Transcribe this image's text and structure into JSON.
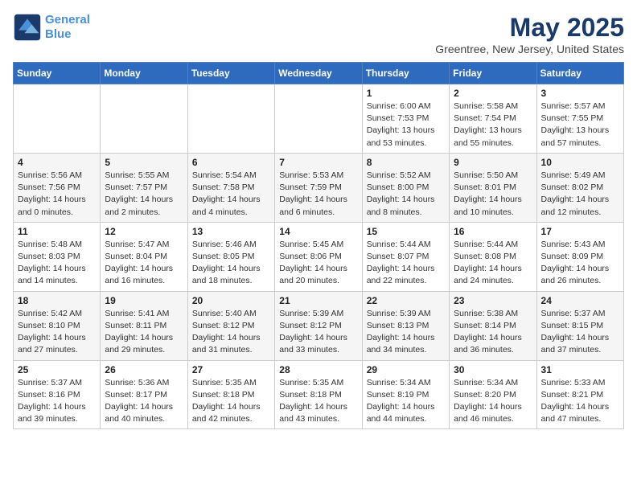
{
  "header": {
    "logo_line1": "General",
    "logo_line2": "Blue",
    "month": "May 2025",
    "location": "Greentree, New Jersey, United States"
  },
  "weekdays": [
    "Sunday",
    "Monday",
    "Tuesday",
    "Wednesday",
    "Thursday",
    "Friday",
    "Saturday"
  ],
  "weeks": [
    [
      {
        "day": "",
        "info": ""
      },
      {
        "day": "",
        "info": ""
      },
      {
        "day": "",
        "info": ""
      },
      {
        "day": "",
        "info": ""
      },
      {
        "day": "1",
        "info": "Sunrise: 6:00 AM\nSunset: 7:53 PM\nDaylight: 13 hours\nand 53 minutes."
      },
      {
        "day": "2",
        "info": "Sunrise: 5:58 AM\nSunset: 7:54 PM\nDaylight: 13 hours\nand 55 minutes."
      },
      {
        "day": "3",
        "info": "Sunrise: 5:57 AM\nSunset: 7:55 PM\nDaylight: 13 hours\nand 57 minutes."
      }
    ],
    [
      {
        "day": "4",
        "info": "Sunrise: 5:56 AM\nSunset: 7:56 PM\nDaylight: 14 hours\nand 0 minutes."
      },
      {
        "day": "5",
        "info": "Sunrise: 5:55 AM\nSunset: 7:57 PM\nDaylight: 14 hours\nand 2 minutes."
      },
      {
        "day": "6",
        "info": "Sunrise: 5:54 AM\nSunset: 7:58 PM\nDaylight: 14 hours\nand 4 minutes."
      },
      {
        "day": "7",
        "info": "Sunrise: 5:53 AM\nSunset: 7:59 PM\nDaylight: 14 hours\nand 6 minutes."
      },
      {
        "day": "8",
        "info": "Sunrise: 5:52 AM\nSunset: 8:00 PM\nDaylight: 14 hours\nand 8 minutes."
      },
      {
        "day": "9",
        "info": "Sunrise: 5:50 AM\nSunset: 8:01 PM\nDaylight: 14 hours\nand 10 minutes."
      },
      {
        "day": "10",
        "info": "Sunrise: 5:49 AM\nSunset: 8:02 PM\nDaylight: 14 hours\nand 12 minutes."
      }
    ],
    [
      {
        "day": "11",
        "info": "Sunrise: 5:48 AM\nSunset: 8:03 PM\nDaylight: 14 hours\nand 14 minutes."
      },
      {
        "day": "12",
        "info": "Sunrise: 5:47 AM\nSunset: 8:04 PM\nDaylight: 14 hours\nand 16 minutes."
      },
      {
        "day": "13",
        "info": "Sunrise: 5:46 AM\nSunset: 8:05 PM\nDaylight: 14 hours\nand 18 minutes."
      },
      {
        "day": "14",
        "info": "Sunrise: 5:45 AM\nSunset: 8:06 PM\nDaylight: 14 hours\nand 20 minutes."
      },
      {
        "day": "15",
        "info": "Sunrise: 5:44 AM\nSunset: 8:07 PM\nDaylight: 14 hours\nand 22 minutes."
      },
      {
        "day": "16",
        "info": "Sunrise: 5:44 AM\nSunset: 8:08 PM\nDaylight: 14 hours\nand 24 minutes."
      },
      {
        "day": "17",
        "info": "Sunrise: 5:43 AM\nSunset: 8:09 PM\nDaylight: 14 hours\nand 26 minutes."
      }
    ],
    [
      {
        "day": "18",
        "info": "Sunrise: 5:42 AM\nSunset: 8:10 PM\nDaylight: 14 hours\nand 27 minutes."
      },
      {
        "day": "19",
        "info": "Sunrise: 5:41 AM\nSunset: 8:11 PM\nDaylight: 14 hours\nand 29 minutes."
      },
      {
        "day": "20",
        "info": "Sunrise: 5:40 AM\nSunset: 8:12 PM\nDaylight: 14 hours\nand 31 minutes."
      },
      {
        "day": "21",
        "info": "Sunrise: 5:39 AM\nSunset: 8:12 PM\nDaylight: 14 hours\nand 33 minutes."
      },
      {
        "day": "22",
        "info": "Sunrise: 5:39 AM\nSunset: 8:13 PM\nDaylight: 14 hours\nand 34 minutes."
      },
      {
        "day": "23",
        "info": "Sunrise: 5:38 AM\nSunset: 8:14 PM\nDaylight: 14 hours\nand 36 minutes."
      },
      {
        "day": "24",
        "info": "Sunrise: 5:37 AM\nSunset: 8:15 PM\nDaylight: 14 hours\nand 37 minutes."
      }
    ],
    [
      {
        "day": "25",
        "info": "Sunrise: 5:37 AM\nSunset: 8:16 PM\nDaylight: 14 hours\nand 39 minutes."
      },
      {
        "day": "26",
        "info": "Sunrise: 5:36 AM\nSunset: 8:17 PM\nDaylight: 14 hours\nand 40 minutes."
      },
      {
        "day": "27",
        "info": "Sunrise: 5:35 AM\nSunset: 8:18 PM\nDaylight: 14 hours\nand 42 minutes."
      },
      {
        "day": "28",
        "info": "Sunrise: 5:35 AM\nSunset: 8:18 PM\nDaylight: 14 hours\nand 43 minutes."
      },
      {
        "day": "29",
        "info": "Sunrise: 5:34 AM\nSunset: 8:19 PM\nDaylight: 14 hours\nand 44 minutes."
      },
      {
        "day": "30",
        "info": "Sunrise: 5:34 AM\nSunset: 8:20 PM\nDaylight: 14 hours\nand 46 minutes."
      },
      {
        "day": "31",
        "info": "Sunrise: 5:33 AM\nSunset: 8:21 PM\nDaylight: 14 hours\nand 47 minutes."
      }
    ]
  ]
}
